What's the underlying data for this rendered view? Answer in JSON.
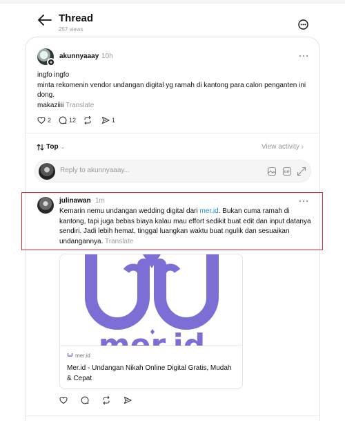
{
  "header": {
    "title": "Thread",
    "views": "257 views"
  },
  "post": {
    "author": "akunnyaaay",
    "time": "10h",
    "lines": [
      "ingfo ingfo",
      "minta rekomenin vendor undangan digital yg ramah di kantong para calon penganten ini dong.",
      "makaziiii"
    ],
    "translate": "Translate",
    "likes": "2",
    "replies": "12",
    "shares": "1"
  },
  "sort": {
    "label": "Top",
    "view_activity": "View activity"
  },
  "reply_box": {
    "placeholder": "Reply to akunnyaaay..."
  },
  "reply": {
    "author": "julinawan",
    "time": "1m",
    "text_before": "Kemarin nemu undangan wedding digital dari ",
    "link": "mer.id",
    "text_after": ". Bukan cuma ramah di kantong, tapi juga bebas biaya kalau mau effort sedikit buat edit dan input datanya sendiri. Jadi lebih hemat, tinggal luangkan waktu buat ngulik dan sesuaikan undangannya.",
    "translate": "Translate",
    "preview": {
      "logo_text": "mer.id",
      "domain": "mer.id",
      "title": "Mer.id - Undangan Nikah Online Digital Gratis, Mudah & Cepat"
    }
  },
  "colors": {
    "highlight": "#e0282e",
    "link": "#1a8fd8",
    "brand_purple": "#7b6fd6"
  }
}
